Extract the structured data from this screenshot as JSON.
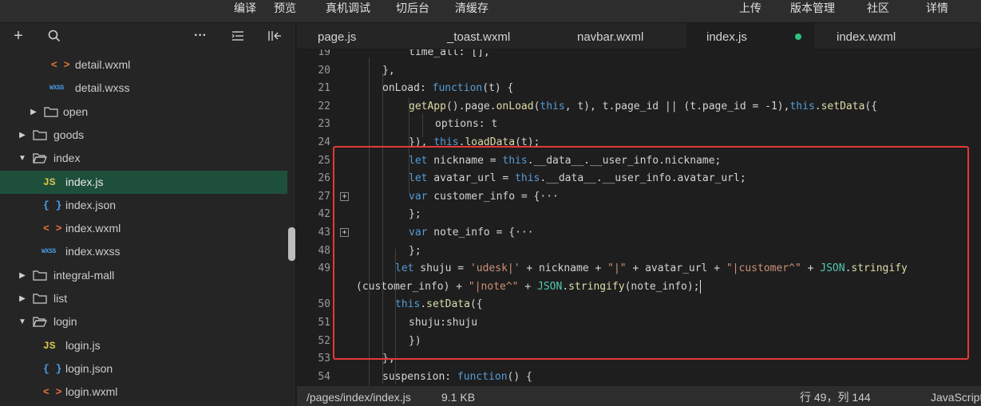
{
  "topbar": {
    "menu": [
      "编译",
      "预览",
      "真机调试",
      "切后台",
      "清缓存"
    ],
    "right": [
      "上传",
      "版本管理",
      "社区",
      "详情"
    ]
  },
  "sidebar": {
    "tools": {
      "add": "+",
      "search": "search-icon",
      "more": "···",
      "collapse": "collapse-icon",
      "split": "split-icon"
    },
    "tree": [
      {
        "name": "detail.wxml",
        "icon": "wxml",
        "type": "file"
      },
      {
        "name": "detail.wxss",
        "icon": "wxss",
        "type": "file"
      },
      {
        "name": "open",
        "type": "folder",
        "expanded": false
      },
      {
        "name": "goods",
        "type": "folder",
        "expanded": false
      },
      {
        "name": "index",
        "type": "folder",
        "expanded": true
      },
      {
        "name": "index.js",
        "icon": "js",
        "type": "file",
        "active": true
      },
      {
        "name": "index.json",
        "icon": "json",
        "type": "file"
      },
      {
        "name": "index.wxml",
        "icon": "wxml",
        "type": "file"
      },
      {
        "name": "index.wxss",
        "icon": "wxss",
        "type": "file"
      },
      {
        "name": "integral-mall",
        "type": "folder",
        "expanded": false
      },
      {
        "name": "list",
        "type": "folder",
        "expanded": false
      },
      {
        "name": "login",
        "type": "folder",
        "expanded": true
      },
      {
        "name": "login.js",
        "icon": "js",
        "type": "file"
      },
      {
        "name": "login.json",
        "icon": "json",
        "type": "file"
      },
      {
        "name": "login.wxml",
        "icon": "wxml",
        "type": "file"
      }
    ],
    "icon_glyphs": {
      "wxml": "< >",
      "wxss": "WXSS",
      "js": "JS",
      "json": "{ }"
    }
  },
  "tabs": [
    {
      "label": "page.js"
    },
    {
      "label": "_toast.wxml"
    },
    {
      "label": "navbar.wxml"
    },
    {
      "label": "index.js",
      "active": true,
      "modified": true
    },
    {
      "label": "index.wxml"
    }
  ],
  "editor": {
    "lines": [
      {
        "num": "19",
        "tokens": [
          [
            "prop",
            "time_all: [],"
          ]
        ]
      },
      {
        "num": "20",
        "tokens": [
          [
            "prop",
            "},"
          ]
        ]
      },
      {
        "num": "21",
        "tokens": [
          [
            "prop",
            "onLoad: "
          ],
          [
            "kw",
            "function"
          ],
          [
            "prop",
            "(t) {"
          ]
        ]
      },
      {
        "num": "22",
        "tokens": [
          [
            "fn",
            "getApp"
          ],
          [
            "prop",
            "().page."
          ],
          [
            "fn",
            "onLoad"
          ],
          [
            "prop",
            "("
          ],
          [
            "kw",
            "this"
          ],
          [
            "prop",
            ", t), t.page_id || (t.page_id = -1),"
          ],
          [
            "kw",
            "this"
          ],
          [
            "prop",
            "."
          ],
          [
            "fn",
            "setData"
          ],
          [
            "prop",
            "({"
          ]
        ]
      },
      {
        "num": "23",
        "tokens": [
          [
            "prop",
            "options: t"
          ]
        ]
      },
      {
        "num": "24",
        "tokens": [
          [
            "prop",
            "}), "
          ],
          [
            "kw",
            "this"
          ],
          [
            "prop",
            "."
          ],
          [
            "fn",
            "loadData"
          ],
          [
            "prop",
            "(t);"
          ]
        ]
      },
      {
        "num": "25",
        "tokens": [
          [
            "kw",
            "let"
          ],
          [
            "prop",
            " nickname = "
          ],
          [
            "kw",
            "this"
          ],
          [
            "prop",
            ".__data__.__user_info.nickname;"
          ]
        ]
      },
      {
        "num": "26",
        "tokens": [
          [
            "kw",
            "let"
          ],
          [
            "prop",
            " avatar_url = "
          ],
          [
            "kw",
            "this"
          ],
          [
            "prop",
            ".__data__.__user_info.avatar_url;"
          ]
        ]
      },
      {
        "num": "27",
        "fold": "+",
        "tokens": [
          [
            "kw",
            "var"
          ],
          [
            "prop",
            " customer_info = {"
          ],
          [
            "prop",
            "···"
          ]
        ]
      },
      {
        "num": "42",
        "tokens": [
          [
            "prop",
            "};"
          ]
        ]
      },
      {
        "num": "43",
        "fold": "+",
        "tokens": [
          [
            "kw",
            "var"
          ],
          [
            "prop",
            " note_info = {"
          ],
          [
            "prop",
            "···"
          ]
        ]
      },
      {
        "num": "48",
        "tokens": [
          [
            "prop",
            "};"
          ]
        ]
      },
      {
        "num": "49",
        "tokens": [
          [
            "kw",
            "let"
          ],
          [
            "prop",
            " shuju = "
          ],
          [
            "str",
            "'udesk|'"
          ],
          [
            "prop",
            " + nickname + "
          ],
          [
            "str",
            "\"|\""
          ],
          [
            "prop",
            " + avatar_url + "
          ],
          [
            "str",
            "\"|customer^\""
          ],
          [
            "prop",
            " + "
          ],
          [
            "obj",
            "JSON"
          ],
          [
            "prop",
            "."
          ],
          [
            "fn",
            "stringify"
          ]
        ]
      },
      {
        "num": "",
        "tokens": [
          [
            "prop",
            "(customer_info) + "
          ],
          [
            "str",
            "\"|note^\""
          ],
          [
            "prop",
            " + "
          ],
          [
            "obj",
            "JSON"
          ],
          [
            "prop",
            "."
          ],
          [
            "fn",
            "stringify"
          ],
          [
            "prop",
            "(note_info);"
          ]
        ]
      },
      {
        "num": "50",
        "tokens": [
          [
            "kw",
            "this"
          ],
          [
            "prop",
            "."
          ],
          [
            "fn",
            "setData"
          ],
          [
            "prop",
            "({"
          ]
        ]
      },
      {
        "num": "51",
        "tokens": [
          [
            "prop",
            "shuju:shuju"
          ]
        ]
      },
      {
        "num": "52",
        "tokens": [
          [
            "prop",
            "})"
          ]
        ]
      },
      {
        "num": "53",
        "tokens": [
          [
            "prop",
            "},"
          ]
        ]
      },
      {
        "num": "54",
        "tokens": [
          [
            "prop",
            "suspension: "
          ],
          [
            "kw",
            "function"
          ],
          [
            "prop",
            "() {"
          ]
        ]
      }
    ]
  },
  "status": {
    "path": "/pages/index/index.js",
    "size": "9.1 KB",
    "position": "行 49，列 144",
    "language": "JavaScript"
  },
  "colors": {
    "accent": "#2ec27e",
    "highlight_box": "#e53935",
    "active_row": "#1e4f3b"
  }
}
